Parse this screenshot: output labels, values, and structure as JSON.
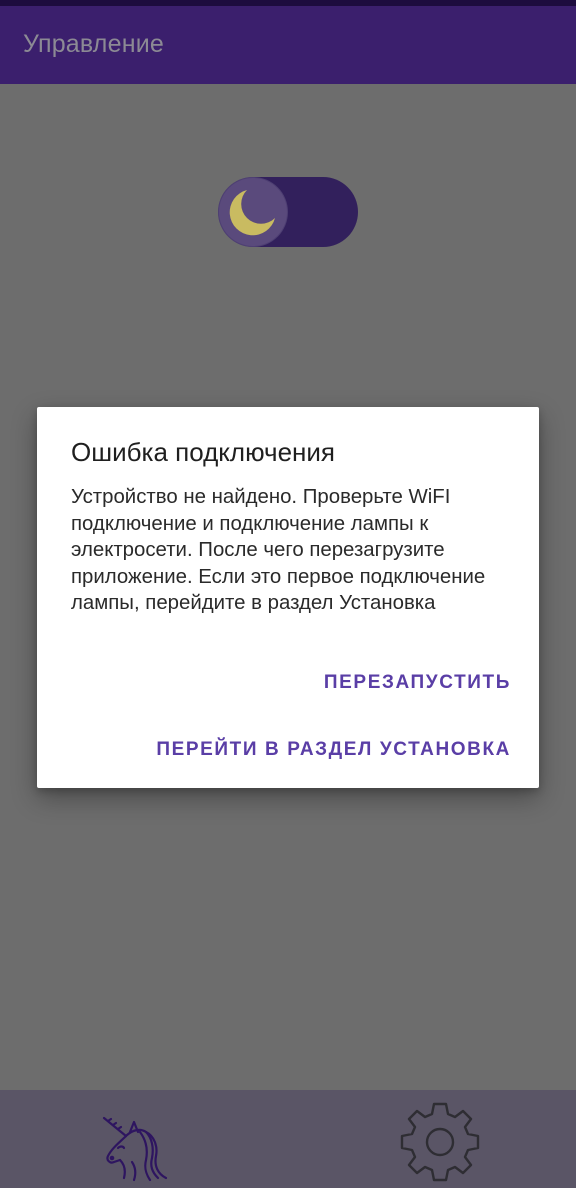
{
  "app_bar": {
    "title": "Управление"
  },
  "night_mode_toggle": {
    "icon": "moon-icon",
    "state": "on"
  },
  "dialog": {
    "title": "Ошибка подключения",
    "message": "Устройство не найдено. Проверьте WiFI подключение и подключение лампы к электросети. После чего перезагрузите приложение. Если это первое подключение лампы, перейдите в раздел Установка",
    "restart_label": "ПЕРЕЗАПУСТИТЬ",
    "goto_setup_label": "ПЕРЕЙТИ В РАЗДЕЛ УСТАНОВКА"
  },
  "bottom_nav": {
    "items": [
      {
        "icon": "unicorn-icon"
      },
      {
        "icon": "gear-icon"
      }
    ]
  },
  "colors": {
    "primary": "#3b1f6d",
    "accent": "#5a3ea6",
    "scrim": "#6d6d6d",
    "moon": "#d6c868"
  }
}
